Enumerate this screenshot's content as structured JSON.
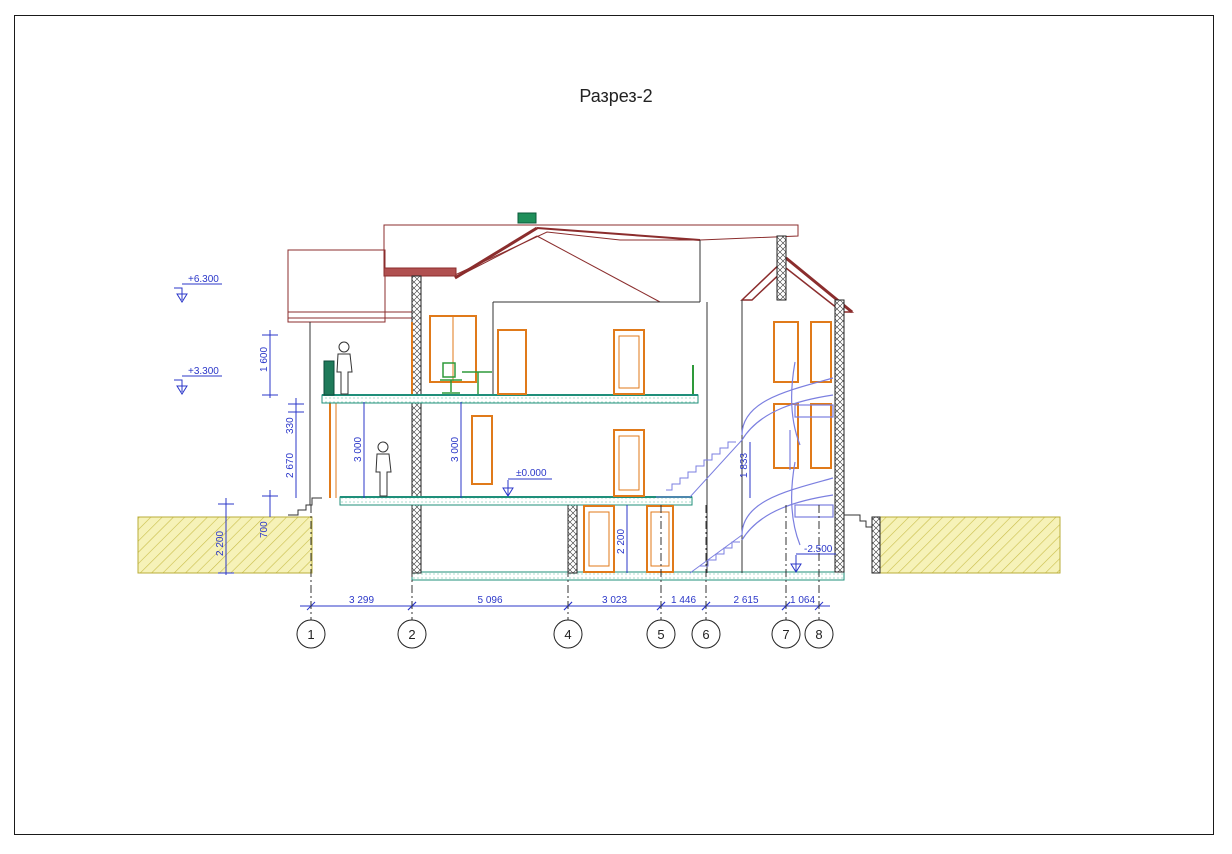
{
  "title": "Разрез-2",
  "levels": {
    "top": "+6.300",
    "second": "+3.300",
    "zero": "±0.000",
    "basement": "-2.500"
  },
  "vertical_dims": {
    "d1600": "1 600",
    "d330": "330",
    "d2670": "2 670",
    "d700": "700",
    "d2200_left": "2 200",
    "d3000_a": "3 000",
    "d3000_b": "3 000",
    "d2200_mid": "2 200",
    "d1833": "1 833"
  },
  "horizontal_dims": [
    "3 299",
    "5 096",
    "3 023",
    "1 446",
    "2 615",
    "1 064"
  ],
  "axes": [
    "1",
    "2",
    "4",
    "5",
    "6",
    "7",
    "8"
  ],
  "colors": {
    "dimension": "#2b37c9",
    "roof": "#8b2d2d",
    "window": "#e07a1a",
    "slab": "#1f8f7a",
    "stair": "#7b7fe0",
    "ground": "#e8e08a"
  }
}
